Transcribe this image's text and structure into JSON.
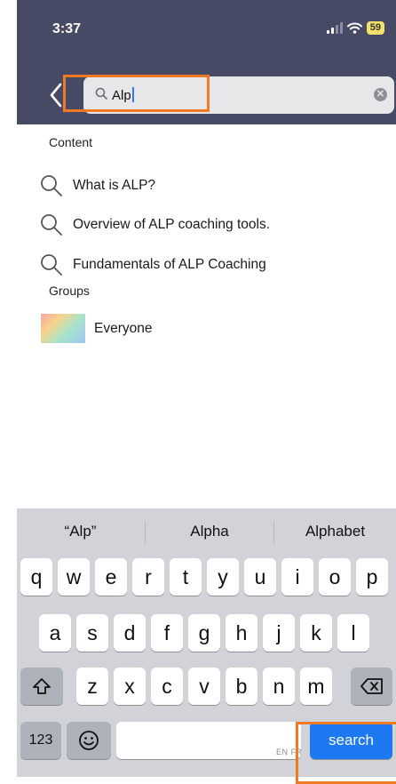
{
  "status_bar": {
    "time": "3:37",
    "battery": "59"
  },
  "search": {
    "value": "Alp"
  },
  "sections": {
    "content_label": "Content",
    "groups_label": "Groups"
  },
  "results": [
    {
      "label": "What is ALP?"
    },
    {
      "label": "Overview of ALP coaching tools."
    },
    {
      "label": "Fundamentals of ALP Coaching"
    }
  ],
  "groups": [
    {
      "label": "Everyone"
    }
  ],
  "keyboard": {
    "suggestions": [
      "“Alp”",
      "Alpha",
      "Alphabet"
    ],
    "row1": [
      "q",
      "w",
      "e",
      "r",
      "t",
      "y",
      "u",
      "i",
      "o",
      "p"
    ],
    "row2": [
      "a",
      "s",
      "d",
      "f",
      "g",
      "h",
      "j",
      "k",
      "l"
    ],
    "row3": [
      "z",
      "x",
      "c",
      "v",
      "b",
      "n",
      "m"
    ],
    "numbers_label": "123",
    "language_hint": "EN FR",
    "action_label": "search"
  },
  "colors": {
    "header_bg": "#474a64",
    "highlight": "#f07a23",
    "action_key": "#1c79f2"
  }
}
